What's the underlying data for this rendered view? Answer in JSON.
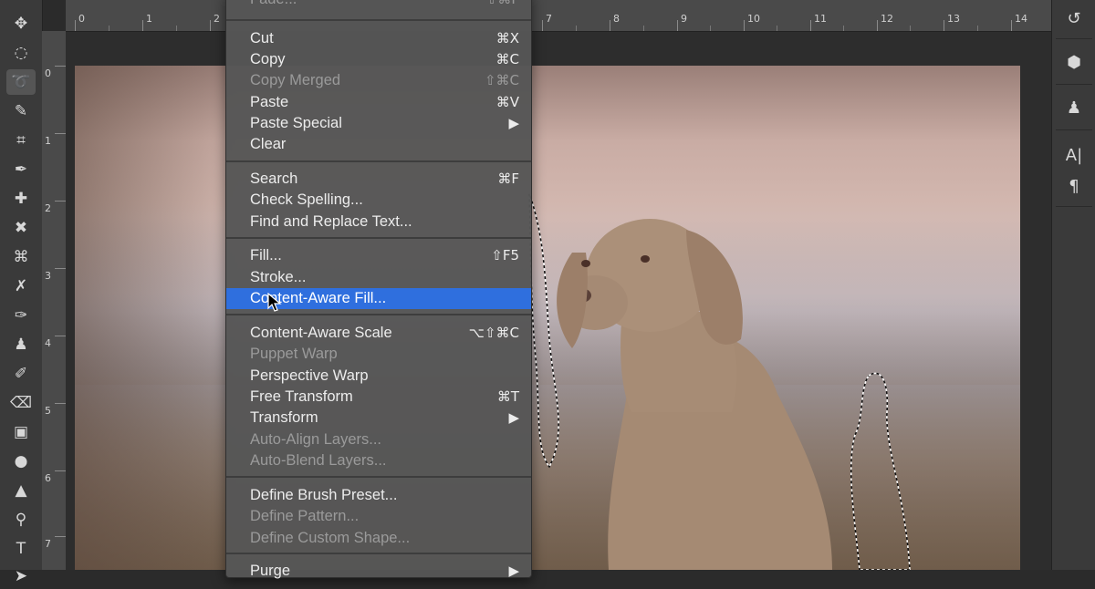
{
  "toolbar": {
    "tools": [
      {
        "name": "move-icon",
        "glyph": "✥"
      },
      {
        "name": "marquee-icon",
        "glyph": "◌"
      },
      {
        "name": "lasso-icon",
        "glyph": "➰"
      },
      {
        "name": "quick-select-icon",
        "glyph": "✎"
      },
      {
        "name": "crop-icon",
        "glyph": "⌗"
      },
      {
        "name": "eyedropper-icon",
        "glyph": "✒"
      },
      {
        "name": "spot-healing-icon",
        "glyph": "✚"
      },
      {
        "name": "healing-brush-icon",
        "glyph": "✖"
      },
      {
        "name": "patch-icon",
        "glyph": "⌘"
      },
      {
        "name": "content-aware-move-icon",
        "glyph": "✗"
      },
      {
        "name": "brush-icon",
        "glyph": "✑"
      },
      {
        "name": "clone-stamp-icon",
        "glyph": "♟"
      },
      {
        "name": "history-brush-icon",
        "glyph": "✐"
      },
      {
        "name": "eraser-icon",
        "glyph": "⌫"
      },
      {
        "name": "gradient-icon",
        "glyph": "▣"
      },
      {
        "name": "blur-icon",
        "glyph": "●"
      },
      {
        "name": "sharpen-icon",
        "glyph": "▲"
      },
      {
        "name": "dodge-icon",
        "glyph": "⚲"
      },
      {
        "name": "type-tool-icon",
        "glyph": "T"
      },
      {
        "name": "path-select-icon",
        "glyph": "➤"
      }
    ]
  },
  "ruler": {
    "top": [
      "0",
      "1",
      "2",
      "7",
      "8",
      "9",
      "10",
      "11",
      "12",
      "13",
      "14"
    ],
    "left": [
      "0",
      "1",
      "2",
      "3",
      "4",
      "5",
      "6",
      "7"
    ]
  },
  "right_panel": {
    "icons": [
      {
        "name": "history-panel-icon",
        "glyph": "↺"
      },
      {
        "name": "3d-panel-icon",
        "glyph": "⬢"
      },
      {
        "name": "clone-source-panel-icon",
        "glyph": "♟"
      },
      {
        "name": "character-panel-icon",
        "glyph": "A|"
      },
      {
        "name": "paragraph-panel-icon",
        "glyph": "¶"
      }
    ]
  },
  "menu": {
    "items": {
      "fade": {
        "label": "Fade...",
        "shortcut": "⇧⌘F"
      },
      "cut": {
        "label": "Cut",
        "shortcut": "⌘X"
      },
      "copy": {
        "label": "Copy",
        "shortcut": "⌘C"
      },
      "copy_merged": {
        "label": "Copy Merged",
        "shortcut": "⇧⌘C"
      },
      "paste": {
        "label": "Paste",
        "shortcut": "⌘V"
      },
      "paste_special": {
        "label": "Paste Special",
        "shortcut": "▶"
      },
      "clear": {
        "label": "Clear",
        "shortcut": ""
      },
      "search": {
        "label": "Search",
        "shortcut": "⌘F"
      },
      "check_spelling": {
        "label": "Check Spelling...",
        "shortcut": ""
      },
      "find_replace": {
        "label": "Find and Replace Text...",
        "shortcut": ""
      },
      "fill": {
        "label": "Fill...",
        "shortcut": "⇧F5"
      },
      "stroke": {
        "label": "Stroke...",
        "shortcut": ""
      },
      "content_aware_fill": {
        "label": "Content-Aware Fill...",
        "shortcut": ""
      },
      "content_aware_scale": {
        "label": "Content-Aware Scale",
        "shortcut": "⌥⇧⌘C"
      },
      "puppet_warp": {
        "label": "Puppet Warp",
        "shortcut": ""
      },
      "perspective_warp": {
        "label": "Perspective Warp",
        "shortcut": ""
      },
      "free_transform": {
        "label": "Free Transform",
        "shortcut": "⌘T"
      },
      "transform": {
        "label": "Transform",
        "shortcut": "▶"
      },
      "auto_align": {
        "label": "Auto-Align Layers...",
        "shortcut": ""
      },
      "auto_blend": {
        "label": "Auto-Blend Layers...",
        "shortcut": ""
      },
      "define_brush": {
        "label": "Define Brush Preset...",
        "shortcut": ""
      },
      "define_pattern": {
        "label": "Define Pattern...",
        "shortcut": ""
      },
      "define_shape": {
        "label": "Define Custom Shape...",
        "shortcut": ""
      },
      "purge": {
        "label": "Purge",
        "shortcut": "▶"
      }
    }
  }
}
